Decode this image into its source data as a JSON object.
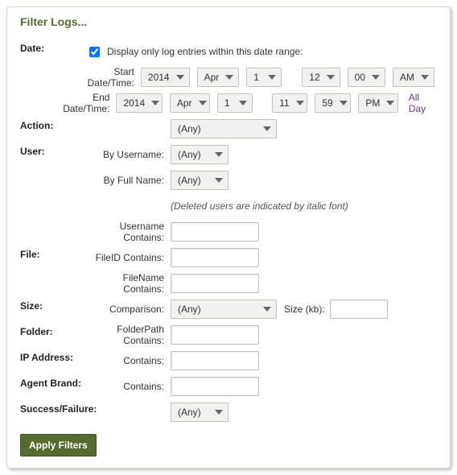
{
  "title": "Filter Logs...",
  "date": {
    "section_label": "Date:",
    "checkbox_label": "Display only log entries within this date range:",
    "start_label": "Start Date/Time:",
    "end_label": "End Date/Time:",
    "start": {
      "year": "2014",
      "month": "Apr",
      "day": "1",
      "hour": "12",
      "minute": "00",
      "ampm": "AM"
    },
    "end": {
      "year": "2014",
      "month": "Apr",
      "day": "1",
      "hour": "11",
      "minute": "59",
      "ampm": "PM"
    },
    "all_day": "All Day"
  },
  "action": {
    "section_label": "Action:",
    "value": "(Any)"
  },
  "user": {
    "section_label": "User:",
    "by_username_label": "By Username:",
    "by_username_value": "(Any)",
    "by_fullname_label": "By Full Name:",
    "by_fullname_value": "(Any)",
    "deleted_note": "(Deleted users are indicated by italic font)",
    "username_contains_label": "Username Contains:"
  },
  "file": {
    "section_label": "File:",
    "fileid_label": "FileID Contains:",
    "filename_label": "FileName Contains:"
  },
  "size": {
    "section_label": "Size:",
    "comparison_label": "Comparison:",
    "comparison_value": "(Any)",
    "size_kb_label": "Size (kb):"
  },
  "folder": {
    "section_label": "Folder:",
    "path_label": "FolderPath Contains:"
  },
  "ip": {
    "section_label": "IP Address:",
    "contains_label": "Contains:"
  },
  "agent": {
    "section_label": "Agent Brand:",
    "contains_label": "Contains:"
  },
  "success": {
    "section_label": "Success/Failure:",
    "value": "(Any)"
  },
  "apply_button": "Apply Filters"
}
